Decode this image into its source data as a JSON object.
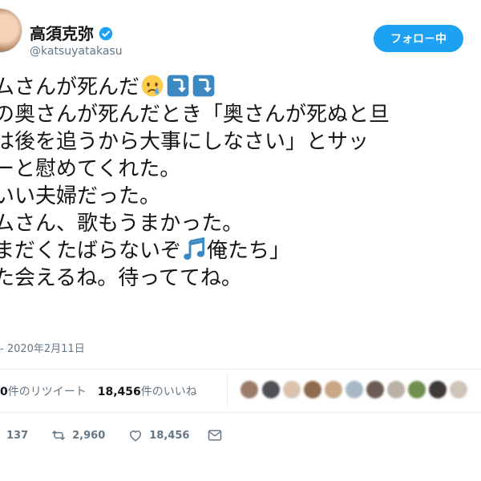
{
  "user": {
    "name": "高須克弥",
    "handle": "@katsuyatakasu",
    "verified": true
  },
  "follow_button": {
    "label": "フォロ－中"
  },
  "tweet": {
    "lines": [
      "ムさんが死んだ",
      "の奥さんが死んだとき「奥さんが死ぬと旦",
      "は後を追うから大事にしなさい」とサッ",
      "ーと慰めてくれた。",
      "いい夫婦だった。",
      "ムさん、歌もうまかった。",
      "まだくたばらないぞ",
      "た会えるね。待っててね。"
    ],
    "line7_suffix": "俺たち」",
    "emojis": [
      "crying-face-icon",
      "down-arrow-icon",
      "down-arrow-icon",
      "musical-notes-icon"
    ],
    "timestamp": "- 2020年2月11日"
  },
  "stats": {
    "retweets_count": "0",
    "retweets_label": "件のリツイート",
    "likes_count": "18,456",
    "likes_label": "件のいいね"
  },
  "actions": {
    "replies": "137",
    "retweets": "2,960",
    "likes": "18,456"
  },
  "colors": {
    "accent": "#1da1f2",
    "text": "#14171a",
    "muted": "#657786",
    "border": "#e6ecf0"
  }
}
